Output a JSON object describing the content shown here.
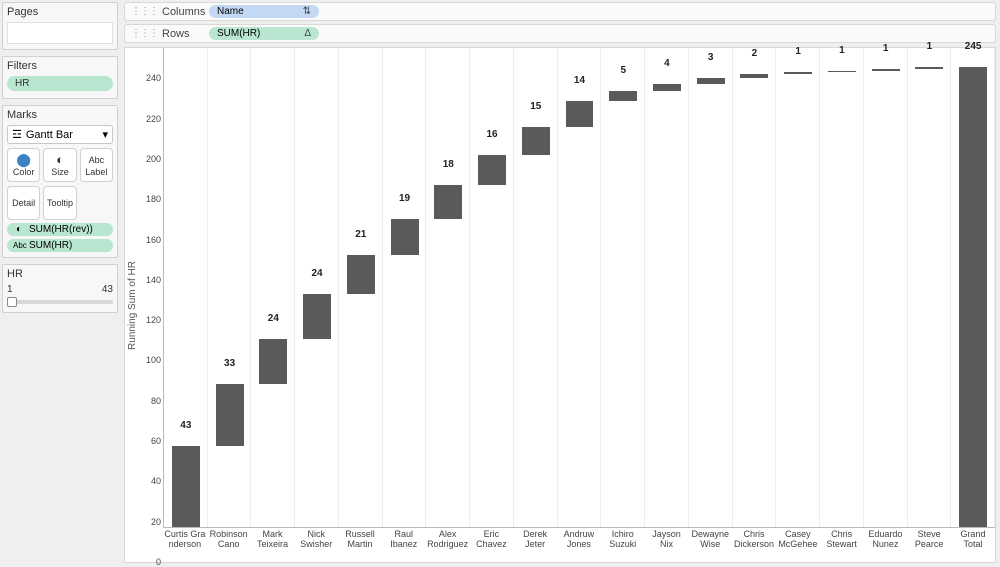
{
  "side": {
    "pages_title": "Pages",
    "filters_title": "Filters",
    "filters_pill": "HR",
    "marks_title": "Marks",
    "marks_type": "Gantt Bar",
    "marks_cells": [
      "Color",
      "Size",
      "Label",
      "Detail",
      "Tooltip",
      ""
    ],
    "mark_pill1": "SUM(HR(rev))",
    "mark_pill2": "SUM(HR)",
    "slider_title": "HR",
    "slider_min": "1",
    "slider_max": "43"
  },
  "shelves": {
    "columns_label": "Columns",
    "columns_pill": "Name",
    "rows_label": "Rows",
    "rows_pill": "SUM(HR)"
  },
  "y_axis_title": "Running Sum of HR",
  "y_ticks": [
    0,
    20,
    40,
    60,
    80,
    100,
    120,
    140,
    160,
    180,
    200,
    220,
    240
  ],
  "chart_data": {
    "type": "bar",
    "ylabel": "Running Sum of HR",
    "ylim": [
      0,
      255
    ],
    "categories": [
      "Curtis Gra\nnderson",
      "Robinson\nCano",
      "Mark\nTeixeira",
      "Nick\nSwisher",
      "Russell\nMartin",
      "Raul\nIbanez",
      "Alex\nRodriguez",
      "Eric\nChavez",
      "Derek\nJeter",
      "Andruw\nJones",
      "Ichiro\nSuzuki",
      "Jayson Nix",
      "Dewayne\nWise",
      "Chris\nDickerson",
      "Casey\nMcGehee",
      "Chris\nStewart",
      "Eduardo\nNunez",
      "Steve\nPearce",
      "Grand\nTotal"
    ],
    "values": [
      43,
      33,
      24,
      24,
      21,
      19,
      18,
      16,
      15,
      14,
      5,
      4,
      3,
      2,
      1,
      1,
      1,
      1,
      245
    ],
    "running_start": [
      0,
      43,
      76,
      100,
      124,
      145,
      164,
      182,
      198,
      213,
      227,
      232,
      236,
      239,
      241,
      242,
      243,
      244,
      0
    ],
    "bar_fill": "#5a5a5a"
  }
}
